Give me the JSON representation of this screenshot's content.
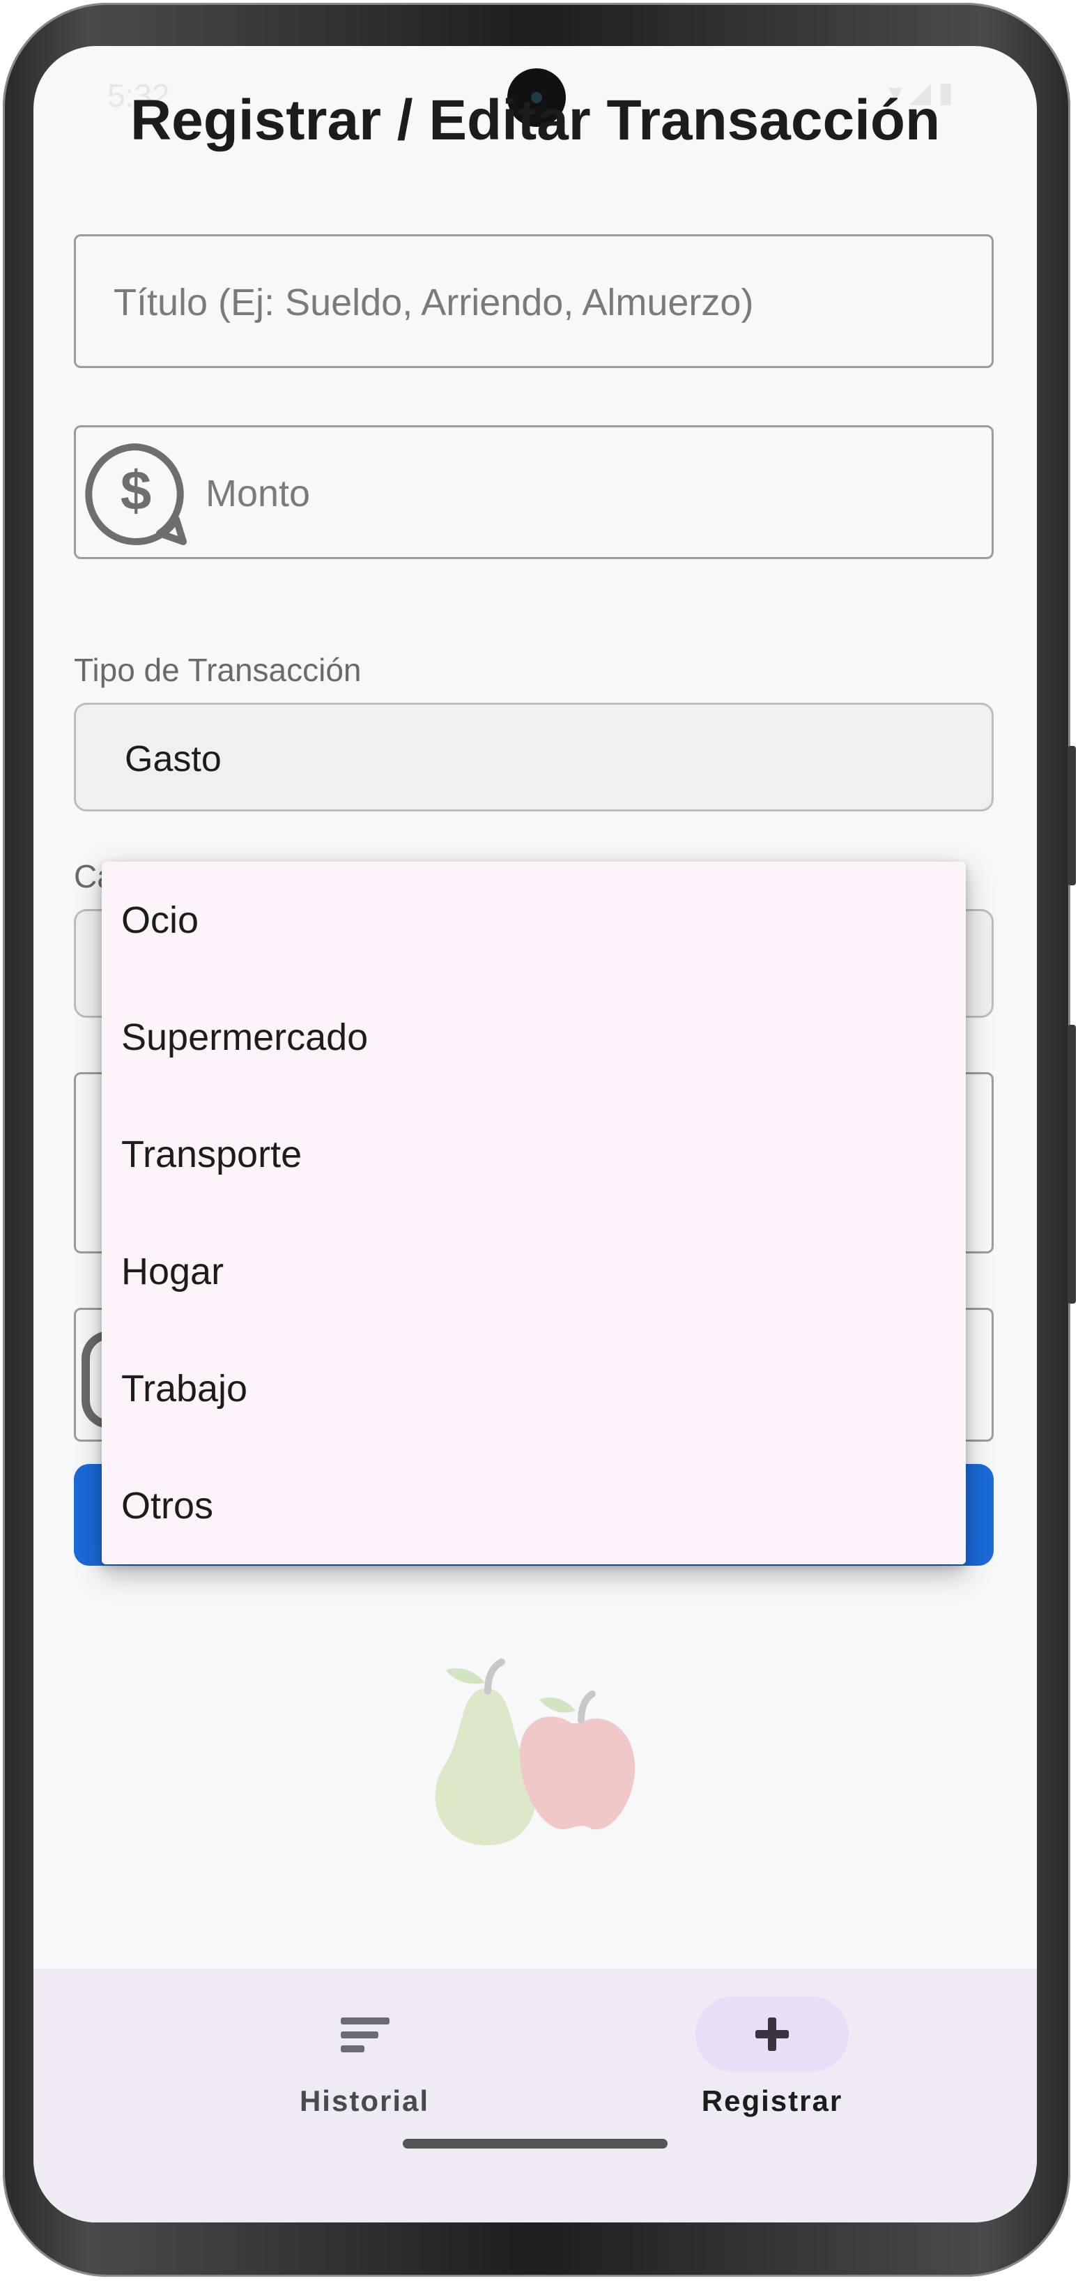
{
  "status_bar": {
    "time": "5:32",
    "icons": "▾◢▮"
  },
  "page": {
    "title": "Registrar / Editar Transacción"
  },
  "form": {
    "title_placeholder": "Título (Ej: Sueldo, Arriendo, Almuerzo)",
    "amount_placeholder": "Monto",
    "amount_icon": "dollar-chat-icon",
    "type_label": "Tipo de Transacción",
    "type_value": "Gasto",
    "category_label": "Categoría"
  },
  "category_menu": {
    "options": [
      "Ocio",
      "Supermercado",
      "Transporte",
      "Hogar",
      "Trabajo",
      "Otros"
    ]
  },
  "bottom_nav": {
    "items": [
      {
        "label": "Historial",
        "icon": "list-icon",
        "selected": false
      },
      {
        "label": "Registrar",
        "icon": "plus-icon",
        "selected": true
      }
    ]
  },
  "colors": {
    "primary_button": "#1a6ad9",
    "menu_background": "#fcf4fa",
    "nav_background": "#f0eaf5",
    "nav_selected_pill": "#e8def8"
  }
}
